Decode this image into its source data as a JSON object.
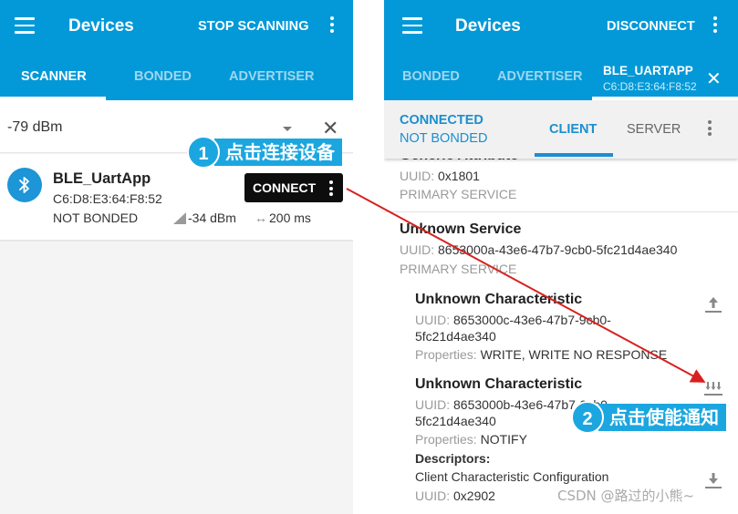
{
  "left": {
    "appbar": {
      "title": "Devices",
      "action": "STOP SCANNING",
      "menu_icon": "hamburger-menu-icon",
      "more_icon": "more-vertical-icon"
    },
    "tabs": [
      {
        "label": "SCANNER",
        "active": true
      },
      {
        "label": "BONDED",
        "active": false
      },
      {
        "label": "ADVERTISER",
        "active": false
      }
    ],
    "filter": {
      "rssi_value": "-79 dBm",
      "dropdown_icon": "dropdown-arrow-icon",
      "clear_icon": "close-icon"
    },
    "device": {
      "name": "BLE_UartApp",
      "mac": "C6:D8:E3:64:F8:52",
      "bond_state": "NOT BONDED",
      "rssi": "-34 dBm",
      "interval": "200 ms",
      "interval_glyph": "↔",
      "connect_label": "CONNECT",
      "icon": "bluetooth-icon"
    }
  },
  "right": {
    "appbar": {
      "title": "Devices",
      "action": "DISCONNECT",
      "menu_icon": "hamburger-menu-icon",
      "more_icon": "more-vertical-icon"
    },
    "tabs": [
      {
        "label": "BONDED",
        "active": false
      },
      {
        "label": "ADVERTISER",
        "active": false
      },
      {
        "label": "BLE_UARTAPP",
        "sublabel": "C6:D8:E3:64:F8:52",
        "active": true
      }
    ],
    "status": {
      "connection": "CONNECTED",
      "bond": "NOT BONDED",
      "subtabs": [
        {
          "label": "CLIENT",
          "active": true
        },
        {
          "label": "SERVER",
          "active": false
        }
      ]
    },
    "services": [
      {
        "name": "Generic Attribute",
        "uuid_label": "UUID:",
        "uuid": "0x1801",
        "type": "PRIMARY SERVICE"
      },
      {
        "name": "Unknown Service",
        "uuid_label": "UUID:",
        "uuid": "8653000a-43e6-47b7-9cb0-5fc21d4ae340",
        "type": "PRIMARY SERVICE",
        "characteristics": [
          {
            "name": "Unknown Characteristic",
            "uuid_label": "UUID:",
            "uuid_line1": "8653000c-43e6-47b7-9cb0-",
            "uuid_line2": "5fc21d4ae340",
            "props_label": "Properties:",
            "props": "WRITE, WRITE NO RESPONSE",
            "action_icon": "upload-write-icon"
          },
          {
            "name": "Unknown Characteristic",
            "uuid_label": "UUID:",
            "uuid_line1": "8653000b-43e6-47b7-9cb0-",
            "uuid_line2": "5fc21d4ae340",
            "props_label": "Properties:",
            "props": "NOTIFY",
            "action_icon": "enable-notify-icon",
            "descriptors_label": "Descriptors:",
            "descriptor": {
              "name": "Client Characteristic Configuration",
              "uuid_label": "UUID:",
              "uuid": "0x2902",
              "action_icon": "download-read-icon"
            }
          }
        ]
      }
    ]
  },
  "annotations": [
    {
      "number": "1",
      "text": "点击连接设备"
    },
    {
      "number": "2",
      "text": "点击使能通知"
    }
  ],
  "watermark": "CSDN @路过的小熊~",
  "colors": {
    "primary": "#0399d8",
    "accent": "#1a8fd0",
    "callout": "#1ba6e0",
    "arrow": "#d8201e"
  }
}
